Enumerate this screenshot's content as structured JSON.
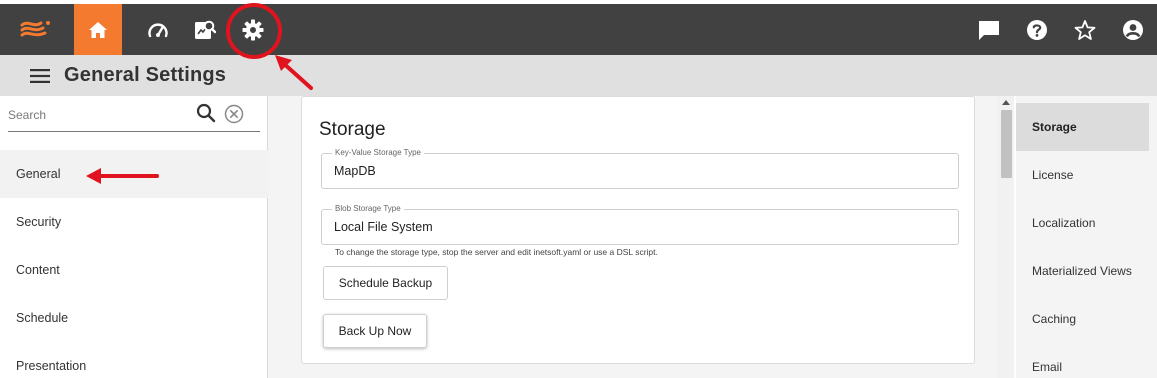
{
  "topbar": {
    "icons": {
      "logo": "logo-icon",
      "home": "home-icon",
      "dashboard": "speedometer-icon",
      "monitor": "monitor-icon",
      "settings": "gear-icon",
      "chat": "chat-icon",
      "help": "help-icon",
      "favorites": "star-icon",
      "account": "account-icon"
    },
    "colors": {
      "bar": "#414141",
      "home_active": "#f37a2e",
      "annotation": "#e0141e"
    }
  },
  "titlebar": {
    "title": "General Settings"
  },
  "sidebar": {
    "search_placeholder": "Search",
    "items": [
      {
        "label": "General"
      },
      {
        "label": "Security"
      },
      {
        "label": "Content"
      },
      {
        "label": "Schedule"
      },
      {
        "label": "Presentation"
      }
    ]
  },
  "main": {
    "section_title": "Storage",
    "kv_field": {
      "label": "Key-Value Storage Type",
      "value": "MapDB"
    },
    "blob_field": {
      "label": "Blob Storage Type",
      "value": "Local File System"
    },
    "hint": "To change the storage type, stop the server and edit inetsoft.yaml or use a DSL script.",
    "buttons": {
      "schedule_backup": "Schedule Backup",
      "back_up_now": "Back Up Now"
    }
  },
  "rightnav": {
    "items": [
      {
        "label": "Storage"
      },
      {
        "label": "License"
      },
      {
        "label": "Localization"
      },
      {
        "label": "Materialized Views"
      },
      {
        "label": "Caching"
      },
      {
        "label": "Email"
      }
    ]
  }
}
